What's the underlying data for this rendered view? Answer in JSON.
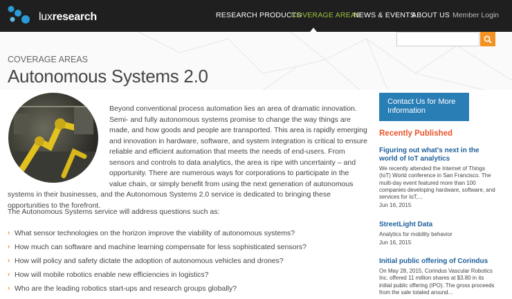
{
  "brand": {
    "name_light": "lux",
    "name_bold": "research"
  },
  "nav": {
    "items": [
      {
        "label": "RESEARCH PRODUCTS"
      },
      {
        "label": "COVERAGE AREAS"
      },
      {
        "label": "NEWS & EVENTS"
      },
      {
        "label": "ABOUT US"
      }
    ],
    "member_login": "Member Login",
    "active_color": "#9cc43c"
  },
  "search": {
    "placeholder": "",
    "button_color": "#f29222",
    "icon": "search-icon"
  },
  "page": {
    "eyebrow": "COVERAGE AREAS",
    "title": "Autonomous Systems 2.0"
  },
  "intro": {
    "text": "Beyond conventional process automation lies an area of dramatic innovation. Semi- and fully autonomous systems promise to change the way things are made, and how goods and people are transported. This area is rapidly emerging and innovation in hardware, software, and system integration is critical to ensure reliable and efficient automation that meets the needs of end-users. From sensors and controls to data analytics, the area is ripe with uncertainty – and opportunity. There are numerous ways for corporations to participate in the value chain, or simply benefit from using the next generation of autonomous systems in their businesses, and the Autonomous Systems 2.0 service is dedicated to bringing these opportunities to the forefront."
  },
  "questions": {
    "lead": "The Autonomous Systems service will address questions such as:",
    "items": [
      "What sensor technologies on the horizon improve the viability of autonomous systems?",
      "How much can software and machine learning compensate for less sophisticated sensors?",
      "How will policy and safety dictate the adoption of autonomous vehicles and drones?",
      "How will mobile robotics enable new efficiencies in logistics?",
      "Who are the leading robotics start-ups and research groups globally?"
    ],
    "bullet": "›"
  },
  "sidebar": {
    "contact_label": "Contact Us for More Information",
    "contact_color": "#2a7eb6",
    "recent_title": "Recently Published",
    "recent_color": "#e8542a",
    "news": [
      {
        "title": "Figuring out what's next in the world of IoT analytics",
        "body": "We recently attended the Internet of Things (IoT) World conference in San Francisco. The multi-day event featured more than 100 companies developing hardware, software, and services for IoT,...",
        "date": "Jun 16, 2015"
      },
      {
        "title": "StreetLight Data",
        "body": "Analytics for mobility behavior",
        "date": "Jun 16, 2015"
      },
      {
        "title": "Initial public offering of Corindus",
        "body": "On May 28, 2015, Corindus Vascular Robotics Inc. offered 11 million shares at $3.80 in its initial public offering (IPO). The gross proceeds from the sale totaled around...",
        "date": ""
      }
    ]
  }
}
